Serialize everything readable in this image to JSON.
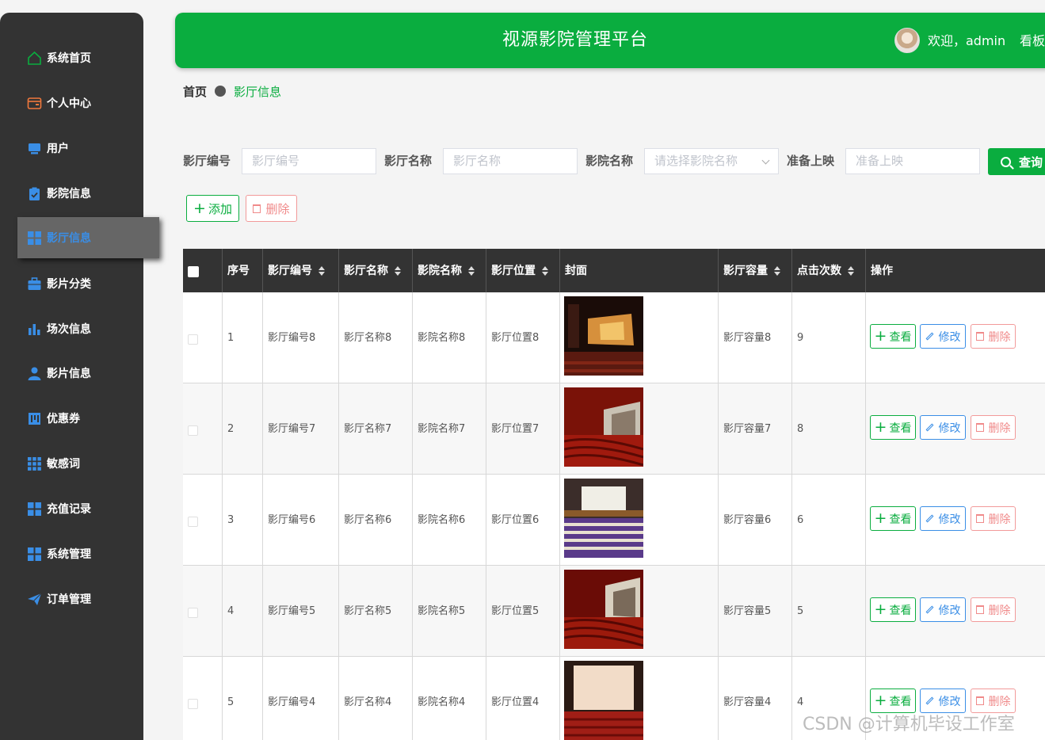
{
  "sidebar": {
    "items": [
      {
        "label": "系统首页",
        "icon": "home-icon"
      },
      {
        "label": "个人中心",
        "icon": "wallet-icon"
      },
      {
        "label": "用户",
        "icon": "monitor-icon"
      },
      {
        "label": "影院信息",
        "icon": "clipboard-check-icon"
      },
      {
        "label": "影厅信息",
        "icon": "grid-icon",
        "active": true
      },
      {
        "label": "影片分类",
        "icon": "briefcase-icon"
      },
      {
        "label": "场次信息",
        "icon": "bar-chart-icon"
      },
      {
        "label": "影片信息",
        "icon": "user-icon"
      },
      {
        "label": "优惠券",
        "icon": "coupon-icon"
      },
      {
        "label": "敏感词",
        "icon": "grid-dots-icon"
      },
      {
        "label": "充值记录",
        "icon": "grid-icon"
      },
      {
        "label": "系统管理",
        "icon": "grid-icon"
      },
      {
        "label": "订单管理",
        "icon": "send-icon"
      }
    ]
  },
  "header": {
    "title": "视源影院管理平台",
    "welcome": "欢迎，admin",
    "board": "看板"
  },
  "breadcrumb": {
    "home": "首页",
    "current": "影厅信息"
  },
  "search": {
    "hall_no_label": "影厅编号",
    "hall_no_placeholder": "影厅编号",
    "hall_name_label": "影厅名称",
    "hall_name_placeholder": "影厅名称",
    "cinema_label": "影院名称",
    "cinema_placeholder": "请选择影院名称",
    "prepare_label": "准备上映",
    "prepare_placeholder": "准备上映",
    "query_label": "查询"
  },
  "actions": {
    "add": "添加",
    "delete": "删除"
  },
  "table": {
    "headers": [
      "序号",
      "影厅编号",
      "影厅名称",
      "影院名称",
      "影厅位置",
      "封面",
      "影厅容量",
      "点击次数",
      "操作"
    ],
    "op_view": "查看",
    "op_edit": "修改",
    "op_delete": "删除",
    "rows": [
      {
        "index": "1",
        "hall_no": "影厅编号8",
        "hall_name": "影厅名称8",
        "cinema": "影院名称8",
        "location": "影厅位置8",
        "capacity": "影厅容量8",
        "clicks": "9"
      },
      {
        "index": "2",
        "hall_no": "影厅编号7",
        "hall_name": "影厅名称7",
        "cinema": "影院名称7",
        "location": "影厅位置7",
        "capacity": "影厅容量7",
        "clicks": "8"
      },
      {
        "index": "3",
        "hall_no": "影厅编号6",
        "hall_name": "影厅名称6",
        "cinema": "影院名称6",
        "location": "影厅位置6",
        "capacity": "影厅容量6",
        "clicks": "6"
      },
      {
        "index": "4",
        "hall_no": "影厅编号5",
        "hall_name": "影厅名称5",
        "cinema": "影院名称5",
        "location": "影厅位置5",
        "capacity": "影厅容量5",
        "clicks": "5"
      },
      {
        "index": "5",
        "hall_no": "影厅编号4",
        "hall_name": "影厅名称4",
        "cinema": "影院名称4",
        "location": "影厅位置4",
        "capacity": "影厅容量4",
        "clicks": "4"
      }
    ]
  },
  "watermark": "CSDN @计算机毕设工作室",
  "colors": {
    "brand_green": "#0aad3f",
    "sidebar_bg": "#333333",
    "active_blue": "#3a8ee6",
    "danger": "#f08a8a"
  }
}
